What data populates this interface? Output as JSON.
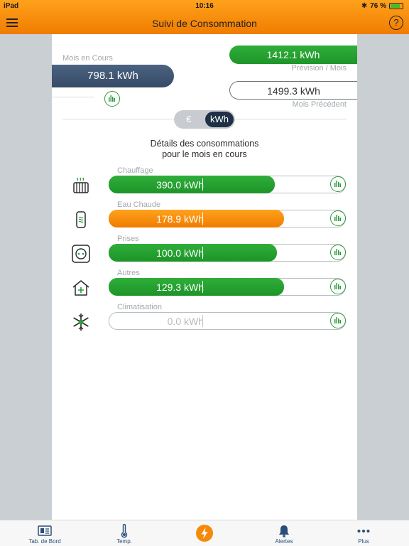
{
  "status_bar": {
    "device": "iPad",
    "time": "10:16",
    "battery": "76 %"
  },
  "header": {
    "title": "Suivi de Consommation",
    "help": "?"
  },
  "summary": {
    "current_label": "Mois en Cours",
    "current_value": "798.1 kWh",
    "forecast_value": "1412.1 kWh",
    "forecast_label": "Prévision / Mois",
    "previous_value": "1499.3 kWh",
    "previous_label": "Mois Précédent"
  },
  "unit_toggle": {
    "euro": "€",
    "kwh": "kWh",
    "selected": "kWh"
  },
  "details": {
    "title_line1": "Détails des consommations",
    "title_line2": "pour le mois en cours"
  },
  "categories": [
    {
      "label": "Chauffage",
      "value": "390.0 kWh",
      "fill": 0.7,
      "color": "green",
      "icon": "radiator-icon"
    },
    {
      "label": "Eau Chaude",
      "value": "178.9 kWh",
      "fill": 0.74,
      "color": "orange",
      "icon": "water-heater-icon"
    },
    {
      "label": "Prises",
      "value": "100.0 kWh",
      "fill": 0.71,
      "color": "green",
      "icon": "outlet-icon"
    },
    {
      "label": "Autres",
      "value": "129.3 kWh",
      "fill": 0.74,
      "color": "green",
      "icon": "house-plus-icon"
    },
    {
      "label": "Climatisation",
      "value": "0.0 kWh",
      "fill": 0.0,
      "color": "none",
      "icon": "snowflake-icon"
    }
  ],
  "tabs": [
    {
      "label": "Tab. de Bord",
      "icon": "dashboard-icon"
    },
    {
      "label": "Temp.",
      "icon": "thermometer-icon"
    },
    {
      "label": "",
      "icon": "lightning-icon"
    },
    {
      "label": "Alertes",
      "icon": "bell-icon"
    },
    {
      "label": "Plus",
      "icon": "more-dots-icon"
    }
  ],
  "colors": {
    "accent": "#f58a0a",
    "green": "#26a233",
    "navy": "#1f3047",
    "tab_text": "#2b4e78"
  }
}
